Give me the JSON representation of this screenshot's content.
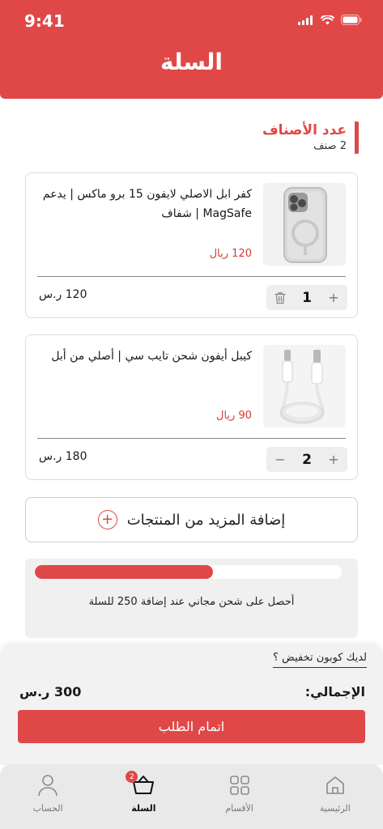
{
  "status_bar": {
    "time": "9:41"
  },
  "header": {
    "title": "السلة"
  },
  "cart_count": {
    "title": "عدد الأصناف",
    "value": "2 صنف"
  },
  "items": [
    {
      "title": "كفر ابل الاصلي لايفون 15 برو ماكس | يدعم MagSafe | شفاف",
      "unit_price": "120 ريال",
      "line_total": "120 ر.س",
      "quantity": "1",
      "left_control": "delete"
    },
    {
      "title": "كيبل أيفون شحن تايب سي | أصلي من أبل",
      "unit_price": "90 ريال",
      "line_total": "180 ر.س",
      "quantity": "2",
      "left_control": "minus"
    }
  ],
  "add_more": {
    "label": "إضافة المزيد من المنتجات"
  },
  "shipping": {
    "progress_percent": 58,
    "text": "أحصل على شحن مجاني عند إضافة 250 للسلة"
  },
  "checkout": {
    "coupon_text": "لديك كوبون تخفيض ؟",
    "total_label": "الإجمالي:",
    "total_value": "300 ر.س",
    "order_button": "اتمام الطلب"
  },
  "nav": {
    "items": [
      {
        "label": "الحساب",
        "icon": "user-icon"
      },
      {
        "label": "السلة",
        "icon": "basket-icon",
        "badge": "2",
        "active": true
      },
      {
        "label": "الأقسام",
        "icon": "grid-icon"
      },
      {
        "label": "الرئيسية",
        "icon": "home-icon"
      }
    ]
  },
  "colors": {
    "accent": "#e04848",
    "price": "#d23b3b"
  }
}
